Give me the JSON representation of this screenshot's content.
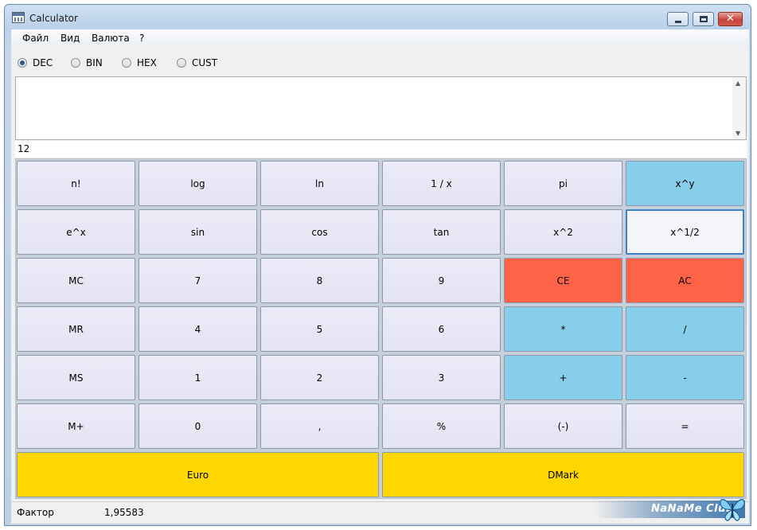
{
  "window": {
    "title": "Calculator",
    "close_glyph": "✕"
  },
  "menu": [
    "Файл",
    "Вид",
    "Валюта",
    "?"
  ],
  "modes": [
    {
      "label": "DEC",
      "checked": true
    },
    {
      "label": "BIN",
      "checked": false
    },
    {
      "label": "HEX",
      "checked": false
    },
    {
      "label": "CUST",
      "checked": false
    }
  ],
  "display": {
    "text": "",
    "result": "12",
    "scroll_up": "▲",
    "scroll_down": "▼"
  },
  "keys": [
    [
      "n!",
      "log",
      "ln",
      "1 / x",
      "pi",
      "x^y"
    ],
    [
      "e^x",
      "sin",
      "cos",
      "tan",
      "x^2",
      "x^1/2"
    ],
    [
      "MC",
      "7",
      "8",
      "9",
      "CE",
      "AC"
    ],
    [
      "MR",
      "4",
      "5",
      "6",
      "*",
      "/"
    ],
    [
      "MS",
      "1",
      "2",
      "3",
      "+",
      "-"
    ],
    [
      "M+",
      "0",
      ",",
      "%",
      "(-)",
      "="
    ],
    [
      "Euro",
      "DMark"
    ]
  ],
  "status": {
    "label": "Фактор",
    "value": "1,95583"
  },
  "watermark": {
    "text": "NaNaMe Club",
    "icon": "butterfly-icon"
  },
  "colors": {
    "key_default": "#e8e8f7",
    "key_operator": "#87ceeb",
    "key_clear": "#ff6347",
    "key_currency": "#ffd700",
    "key_focus_border": "#3c82c8"
  }
}
